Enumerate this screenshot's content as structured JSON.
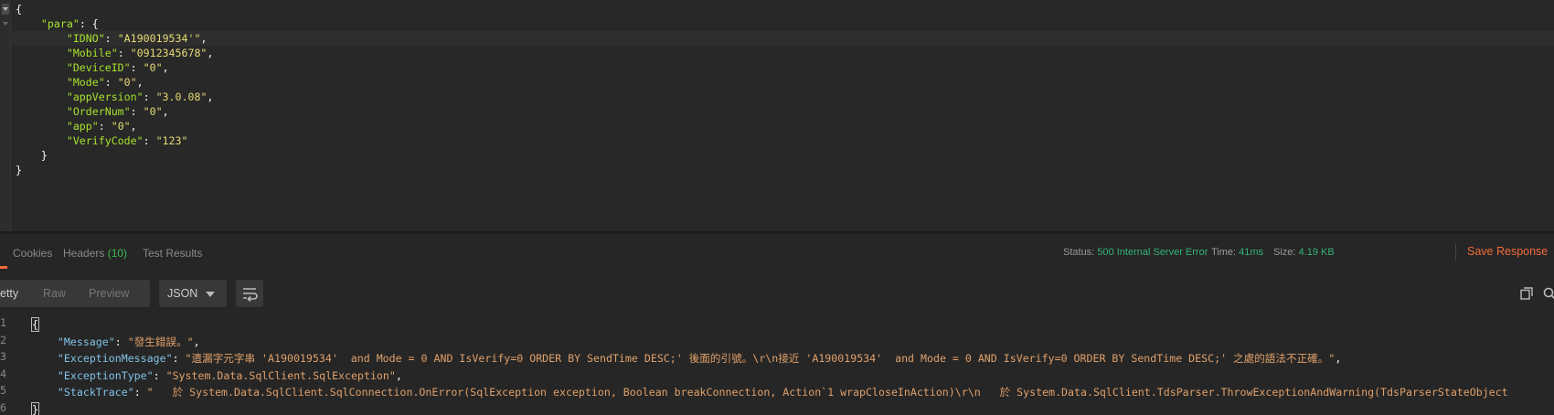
{
  "request": {
    "lines": [
      [
        {
          "t": "{",
          "c": "p"
        }
      ],
      [
        {
          "t": "    ",
          "c": "p"
        },
        {
          "t": "\"para\"",
          "c": "k"
        },
        {
          "t": ": {",
          "c": "p"
        }
      ],
      [
        {
          "t": "        ",
          "c": "p"
        },
        {
          "t": "\"IDNO\"",
          "c": "k"
        },
        {
          "t": ": ",
          "c": "p"
        },
        {
          "t": "\"A190019534'\"",
          "c": "s"
        },
        {
          "t": ",",
          "c": "p"
        }
      ],
      [
        {
          "t": "        ",
          "c": "p"
        },
        {
          "t": "\"Mobile\"",
          "c": "k"
        },
        {
          "t": ": ",
          "c": "p"
        },
        {
          "t": "\"0912345678\"",
          "c": "s"
        },
        {
          "t": ",",
          "c": "p"
        }
      ],
      [
        {
          "t": "        ",
          "c": "p"
        },
        {
          "t": "\"DeviceID\"",
          "c": "k"
        },
        {
          "t": ": ",
          "c": "p"
        },
        {
          "t": "\"0\"",
          "c": "s"
        },
        {
          "t": ",",
          "c": "p"
        }
      ],
      [
        {
          "t": "        ",
          "c": "p"
        },
        {
          "t": "\"Mode\"",
          "c": "k"
        },
        {
          "t": ": ",
          "c": "p"
        },
        {
          "t": "\"0\"",
          "c": "s"
        },
        {
          "t": ",",
          "c": "p"
        }
      ],
      [
        {
          "t": "        ",
          "c": "p"
        },
        {
          "t": "\"appVersion\"",
          "c": "k"
        },
        {
          "t": ": ",
          "c": "p"
        },
        {
          "t": "\"3.0.08\"",
          "c": "s"
        },
        {
          "t": ",",
          "c": "p"
        }
      ],
      [
        {
          "t": "        ",
          "c": "p"
        },
        {
          "t": "\"OrderNum\"",
          "c": "k"
        },
        {
          "t": ": ",
          "c": "p"
        },
        {
          "t": "\"0\"",
          "c": "s"
        },
        {
          "t": ",",
          "c": "p"
        }
      ],
      [
        {
          "t": "        ",
          "c": "p"
        },
        {
          "t": "\"app\"",
          "c": "k"
        },
        {
          "t": ": ",
          "c": "p"
        },
        {
          "t": "\"0\"",
          "c": "s"
        },
        {
          "t": ",",
          "c": "p"
        }
      ],
      [
        {
          "t": "        ",
          "c": "p"
        },
        {
          "t": "\"VerifyCode\"",
          "c": "k"
        },
        {
          "t": ": ",
          "c": "p"
        },
        {
          "t": "\"123\"",
          "c": "s"
        }
      ],
      [
        {
          "t": "    }",
          "c": "p"
        }
      ],
      [
        {
          "t": "}",
          "c": "p"
        }
      ]
    ]
  },
  "tabs": {
    "cookies": "Cookies",
    "headers": "Headers",
    "headers_count": "(10)",
    "test_results": "Test Results"
  },
  "status": {
    "status_label": "Status:",
    "status_value": "500 Internal Server Error",
    "time_label": "Time:",
    "time_value": "41ms",
    "size_label": "Size:",
    "size_value": "4.19 KB",
    "save_label": "Save Response"
  },
  "toolbar": {
    "pretty": "etty",
    "raw": "Raw",
    "preview": "Preview",
    "format": "JSON"
  },
  "response": {
    "line_numbers": [
      "1",
      "2",
      "3",
      "4",
      "5",
      "6"
    ],
    "lines": [
      [
        {
          "t": "{",
          "c": "p"
        }
      ],
      [
        {
          "t": "    ",
          "c": "p"
        },
        {
          "t": "\"Message\"",
          "c": "rk"
        },
        {
          "t": ": ",
          "c": "p"
        },
        {
          "t": "\"發生錯誤。\"",
          "c": "rs"
        },
        {
          "t": ",",
          "c": "p"
        }
      ],
      [
        {
          "t": "    ",
          "c": "p"
        },
        {
          "t": "\"ExceptionMessage\"",
          "c": "rk"
        },
        {
          "t": ": ",
          "c": "p"
        },
        {
          "t": "\"遺漏字元字串 'A190019534'  and Mode = 0 AND IsVerify=0 ORDER BY SendTime DESC;' 後面的引號。\\r\\n接近 'A190019534'  and Mode = 0 AND IsVerify=0 ORDER BY SendTime DESC;' 之處的語法不正確。\"",
          "c": "rs"
        },
        {
          "t": ",",
          "c": "p"
        }
      ],
      [
        {
          "t": "    ",
          "c": "p"
        },
        {
          "t": "\"ExceptionType\"",
          "c": "rk"
        },
        {
          "t": ": ",
          "c": "p"
        },
        {
          "t": "\"System.Data.SqlClient.SqlException\"",
          "c": "rs"
        },
        {
          "t": ",",
          "c": "p"
        }
      ],
      [
        {
          "t": "    ",
          "c": "p"
        },
        {
          "t": "\"StackTrace\"",
          "c": "rk"
        },
        {
          "t": ": ",
          "c": "p"
        },
        {
          "t": "\"   於 System.Data.SqlClient.SqlConnection.OnError(SqlException exception, Boolean breakConnection, Action`1 wrapCloseInAction)\\r\\n   於 System.Data.SqlClient.TdsParser.ThrowExceptionAndWarning(TdsParserStateObject",
          "c": "rs"
        }
      ],
      [
        {
          "t": "}",
          "c": "p"
        }
      ]
    ]
  },
  "icons": {
    "wrap": "wrap-lines-icon",
    "copy": "copy-icon",
    "search": "search-icon"
  },
  "colors": {
    "accent": "#f26b3a",
    "status_ok": "#33b279",
    "json_key": "#a6e22e",
    "json_string": "#e6db74",
    "resp_key": "#7ec3e6",
    "resp_string": "#e0a06a"
  }
}
